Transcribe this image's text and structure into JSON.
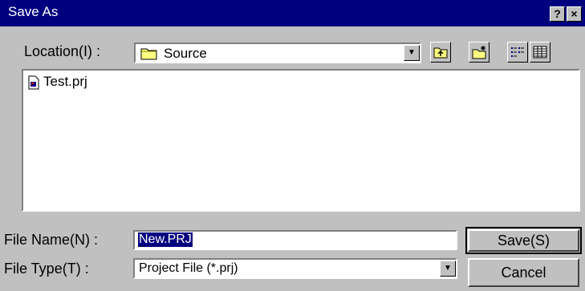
{
  "window": {
    "title": "Save As",
    "help_glyph": "?",
    "close_glyph": "×"
  },
  "location": {
    "label": "Location(I) :",
    "value": "Source",
    "dropdown_glyph": "▼"
  },
  "files": [
    {
      "name": "Test.prj"
    }
  ],
  "filename": {
    "label": "File Name(N) :",
    "value": "New.PRJ"
  },
  "filetype": {
    "label": "File Type(T) :",
    "value": "Project File (*.prj)",
    "dropdown_glyph": "▼"
  },
  "buttons": {
    "save": "Save(S)",
    "cancel": "Cancel"
  },
  "icons": {
    "folder": "folder-icon",
    "up": "up-folder-icon",
    "new_folder": "new-folder-icon",
    "list_view": "list-view-icon",
    "details_view": "details-view-icon",
    "file": "project-file-icon"
  }
}
